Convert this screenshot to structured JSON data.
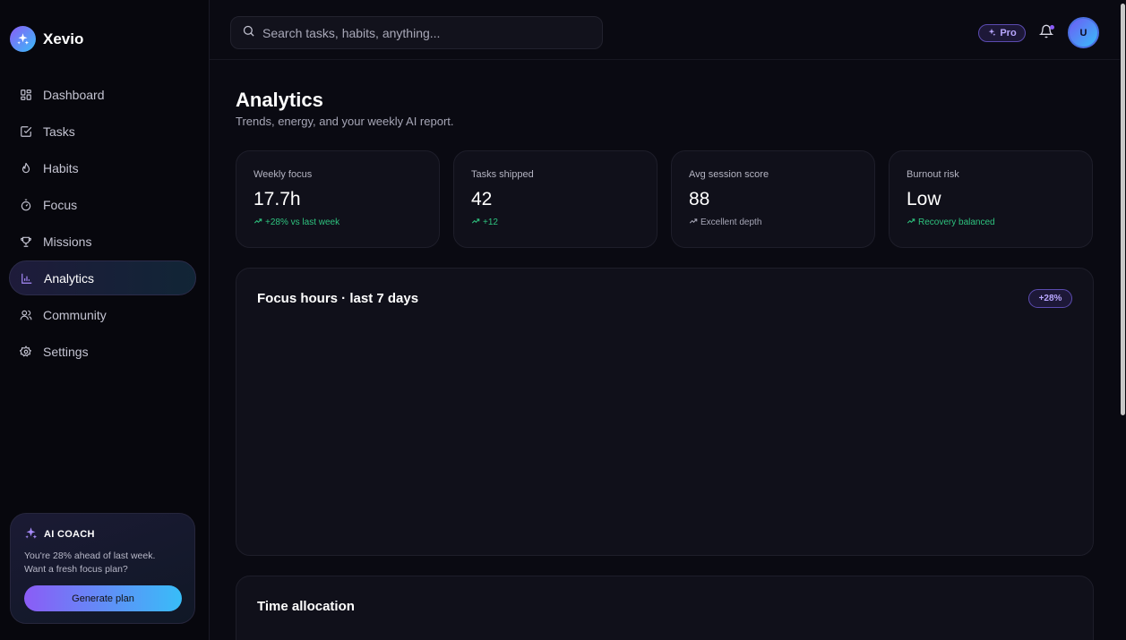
{
  "brand": {
    "name": "Xevio",
    "icon": "sparkle-icon"
  },
  "sidebar": {
    "items": [
      {
        "label": "Dashboard",
        "icon": "grid-icon",
        "active": false
      },
      {
        "label": "Tasks",
        "icon": "checkbox-icon",
        "active": false
      },
      {
        "label": "Habits",
        "icon": "flame-icon",
        "active": false
      },
      {
        "label": "Focus",
        "icon": "timer-icon",
        "active": false
      },
      {
        "label": "Missions",
        "icon": "trophy-icon",
        "active": false
      },
      {
        "label": "Analytics",
        "icon": "bar-chart-icon",
        "active": true
      },
      {
        "label": "Community",
        "icon": "users-icon",
        "active": false
      },
      {
        "label": "Settings",
        "icon": "gear-icon",
        "active": false
      }
    ],
    "coach": {
      "title": "AI COACH",
      "text": "You're 28% ahead of last week. Want a fresh focus plan?",
      "button": "Generate plan"
    }
  },
  "topbar": {
    "search_placeholder": "Search tasks, habits, anything...",
    "pro_label": "Pro",
    "avatar_initial": "U"
  },
  "page": {
    "title": "Analytics",
    "subtitle": "Trends, energy, and your weekly AI report."
  },
  "stats": [
    {
      "label": "Weekly focus",
      "value": "17.7h",
      "delta": "+28% vs last week",
      "tone": "up"
    },
    {
      "label": "Tasks shipped",
      "value": "42",
      "delta": "+12",
      "tone": "up"
    },
    {
      "label": "Avg session score",
      "value": "88",
      "delta": "Excellent depth",
      "tone": "neutral"
    },
    {
      "label": "Burnout risk",
      "value": "Low",
      "delta": "Recovery balanced",
      "tone": "up"
    }
  ],
  "focus_panel": {
    "title": "Focus hours · last 7 days",
    "badge": "+28%"
  },
  "allocation_panel": {
    "title": "Time allocation"
  },
  "colors": {
    "accent": "#8b5cf6",
    "accent2": "#38bdf8",
    "positive": "#2ec27e",
    "background": "#0a0a12"
  }
}
